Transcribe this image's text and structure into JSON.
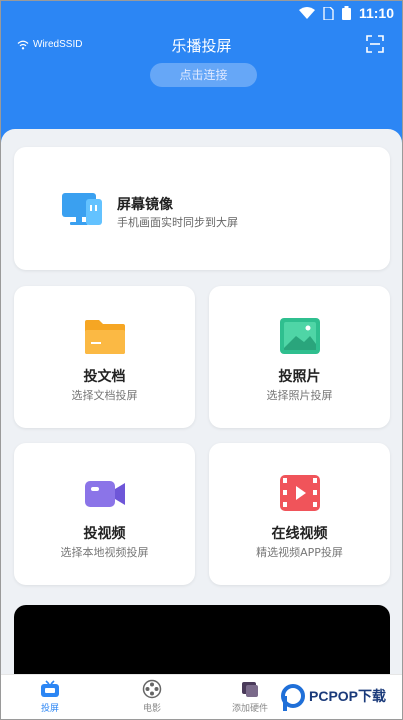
{
  "status_bar": {
    "time": "11:10"
  },
  "top_bar": {
    "wifi_label": "WiredSSID",
    "title": "乐播投屏",
    "connect_button": "点击连接"
  },
  "mirror": {
    "title": "屏幕镜像",
    "subtitle": "手机画面实时同步到大屏"
  },
  "tiles": [
    {
      "title": "投文档",
      "subtitle": "选择文档投屏",
      "icon": "folder-icon"
    },
    {
      "title": "投照片",
      "subtitle": "选择照片投屏",
      "icon": "photo-icon"
    },
    {
      "title": "投视频",
      "subtitle": "选择本地视频投屏",
      "icon": "video-camera-icon"
    },
    {
      "title": "在线视频",
      "subtitle": "精选视频APP投屏",
      "icon": "play-film-icon"
    }
  ],
  "bottom_nav": [
    {
      "label": "投屏",
      "active": true
    },
    {
      "label": "电影"
    },
    {
      "label": "添加硬件"
    }
  ],
  "watermark": {
    "brand": "PCPOP下载"
  },
  "colors": {
    "primary": "#2c86f4",
    "background": "#eef1f5"
  }
}
